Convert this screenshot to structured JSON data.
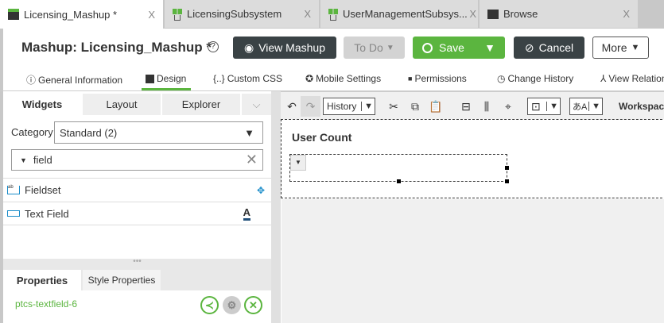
{
  "tabs": [
    {
      "label": "Licensing_Mashup *",
      "icon": "mashup-icon",
      "active": true
    },
    {
      "label": "LicensingSubsystem",
      "icon": "subsystem-icon"
    },
    {
      "label": "UserManagementSubsys...",
      "icon": "subsystem-icon"
    },
    {
      "label": "Browse",
      "icon": "folder-icon"
    }
  ],
  "close_glyph": "X",
  "header": {
    "title": "Mashup: Licensing_Mashup *",
    "help": "?",
    "view_mashup": "View Mashup",
    "todo": "To Do",
    "save": "Save",
    "cancel": "Cancel",
    "more": "More"
  },
  "nav": [
    "General Information",
    "Design",
    "Custom CSS",
    "Mobile Settings",
    "Permissions",
    "Change History",
    "View Relationships"
  ],
  "nav_icons": [
    "ⓘ",
    "▬",
    "{..}",
    "✪",
    "🔒",
    "◷",
    "⚲"
  ],
  "widgets_panel": {
    "tabs": [
      "Widgets",
      "Layout",
      "Explorer"
    ],
    "category_label": "Category",
    "category_value": "Standard (2)",
    "filter_value": "field",
    "items": [
      "Fieldset",
      "Text Field"
    ]
  },
  "properties_panel": {
    "tabs": [
      "Properties",
      "Style Properties"
    ],
    "widget_id": "ptcs-textfield-6"
  },
  "toolbar": {
    "history": "History",
    "workspace": "Workspace"
  },
  "canvas": {
    "label": "User Count"
  },
  "colors": {
    "green": "#5bb53f",
    "dark": "#3a4245",
    "accent_blue": "#1a8cc9"
  }
}
